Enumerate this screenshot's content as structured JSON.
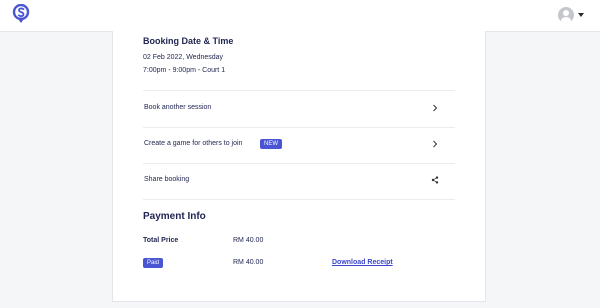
{
  "header": {
    "logo_icon": "brand-logo-icon",
    "avatar_icon": "user-avatar-icon",
    "caret_icon": "caret-down-icon"
  },
  "booking": {
    "title": "Booking Date & Time",
    "date": "02 Feb 2022, Wednesday",
    "time_court": "7:00pm - 9:00pm - Court 1"
  },
  "actions": [
    {
      "label": "Book another session",
      "icon": "chevron-right-icon"
    },
    {
      "label": "Create a game for others to join",
      "badge": "NEW",
      "icon": "chevron-right-icon"
    },
    {
      "label": "Share booking",
      "icon": "share-icon"
    }
  ],
  "payment": {
    "title": "Payment Info",
    "total_label": "Total Price",
    "total_value": "RM 40.00",
    "status_badge": "Paid",
    "paid_value": "RM 40.00",
    "download_label": "Download Receipt"
  },
  "colors": {
    "accent": "#4a55d4",
    "link": "#3b46c8",
    "text": "#1f2450"
  }
}
